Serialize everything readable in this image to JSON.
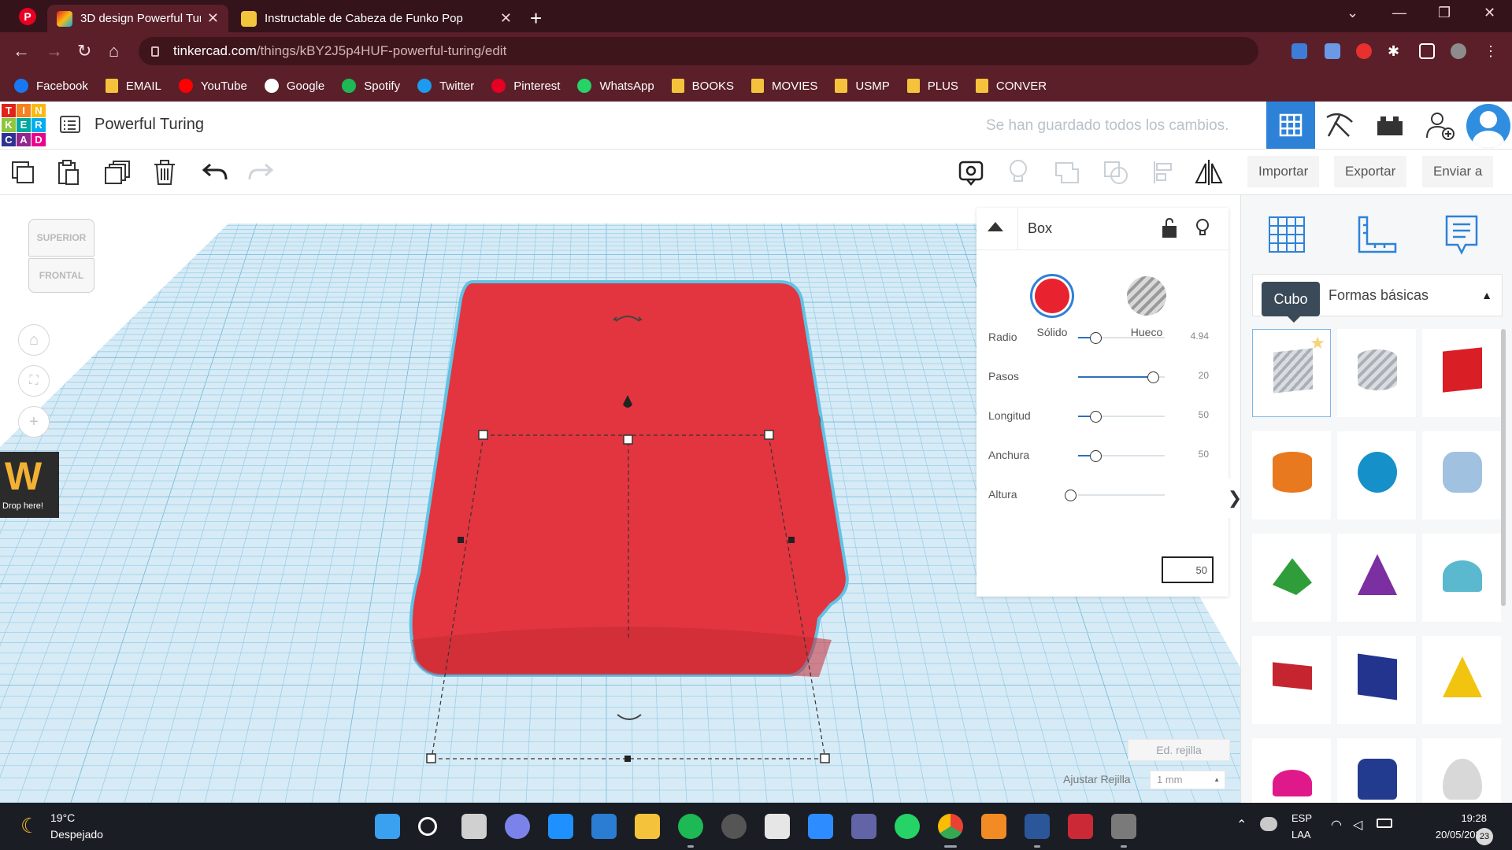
{
  "browser": {
    "tabs": [
      {
        "title": "3D design Powerful Turing | Tinkercad",
        "active": true
      },
      {
        "title": "Instructable de Cabeza de Funko Pop",
        "active": false
      }
    ],
    "url_host": "tinkercad.com",
    "url_path": "/things/kBY2J5p4HUF-powerful-turing/edit",
    "bookmarks": [
      {
        "label": "Facebook",
        "icon": "facebook-icon",
        "color": "#1877f2"
      },
      {
        "label": "EMAIL",
        "icon": "folder-icon",
        "color": "#f5c33b"
      },
      {
        "label": "YouTube",
        "icon": "youtube-icon",
        "color": "#ff0000"
      },
      {
        "label": "Google",
        "icon": "google-icon",
        "color": "#ffffff"
      },
      {
        "label": "Spotify",
        "icon": "spotify-icon",
        "color": "#1db954"
      },
      {
        "label": "Twitter",
        "icon": "twitter-icon",
        "color": "#1d9bf0"
      },
      {
        "label": "Pinterest",
        "icon": "pinterest-icon",
        "color": "#e60023"
      },
      {
        "label": "WhatsApp",
        "icon": "whatsapp-icon",
        "color": "#25d366"
      },
      {
        "label": "BOOKS",
        "icon": "folder-icon",
        "color": "#f5c33b"
      },
      {
        "label": "MOVIES",
        "icon": "folder-icon",
        "color": "#f5c33b"
      },
      {
        "label": "USMP",
        "icon": "folder-icon",
        "color": "#f5c33b"
      },
      {
        "label": "PLUS",
        "icon": "folder-icon",
        "color": "#f5c33b"
      },
      {
        "label": "CONVER",
        "icon": "folder-icon",
        "color": "#f5c33b"
      }
    ]
  },
  "app": {
    "logo_letters": [
      "T",
      "I",
      "N",
      "K",
      "E",
      "R",
      "C",
      "A",
      "D"
    ],
    "logo_colors": [
      "#e2231a",
      "#f58220",
      "#fdb913",
      "#8dc63f",
      "#00a99d",
      "#00aeef",
      "#2e3192",
      "#92278f",
      "#ec008c"
    ],
    "design_title": "Powerful Turing",
    "save_status": "Se han guardado todos los cambios.",
    "accent": "#2d82d8"
  },
  "toolbar": {
    "import_label": "Importar",
    "export_label": "Exportar",
    "send_label": "Enviar a"
  },
  "viewcube": {
    "top": "SUPERIOR",
    "front": "FRONTAL"
  },
  "extension": {
    "label": "Drop here!"
  },
  "inspector": {
    "title": "Box",
    "solid_label": "Sólido",
    "hole_label": "Hueco",
    "solid_color": "#e8232f",
    "props": [
      {
        "label": "Radio",
        "value": "4.94",
        "fraction": 0.14
      },
      {
        "label": "Pasos",
        "value": "20",
        "fraction": 0.8
      },
      {
        "label": "Longitud",
        "value": "50",
        "fraction": 0.14
      },
      {
        "label": "Anchura",
        "value": "50",
        "fraction": 0.14
      },
      {
        "label": "Altura",
        "value": "50",
        "fraction": 0.0
      }
    ]
  },
  "grid": {
    "edit_label": "Ed. rejilla",
    "snap_label": "Ajustar Rejilla",
    "snap_value": "1 mm"
  },
  "shapes_panel": {
    "category": "Formas básicas",
    "tooltip": "Cubo",
    "shape_colors": [
      "#b9bec4",
      "#b9bec4",
      "#d91e25",
      "#e8791e",
      "#1690c9",
      "#8ab2d8",
      "#2f9e3a",
      "#7b2fa0",
      "#5ab8cf",
      "#c5252f",
      "#23348f",
      "#f1c40f",
      "#e0198a",
      "#223b8f",
      "#d8d8d8"
    ]
  },
  "taskbar": {
    "temp": "19°C",
    "condition": "Despejado",
    "lang1": "ESP",
    "lang2": "LAA",
    "time": "19:28",
    "date": "20/05/2022",
    "notifications": "23"
  }
}
